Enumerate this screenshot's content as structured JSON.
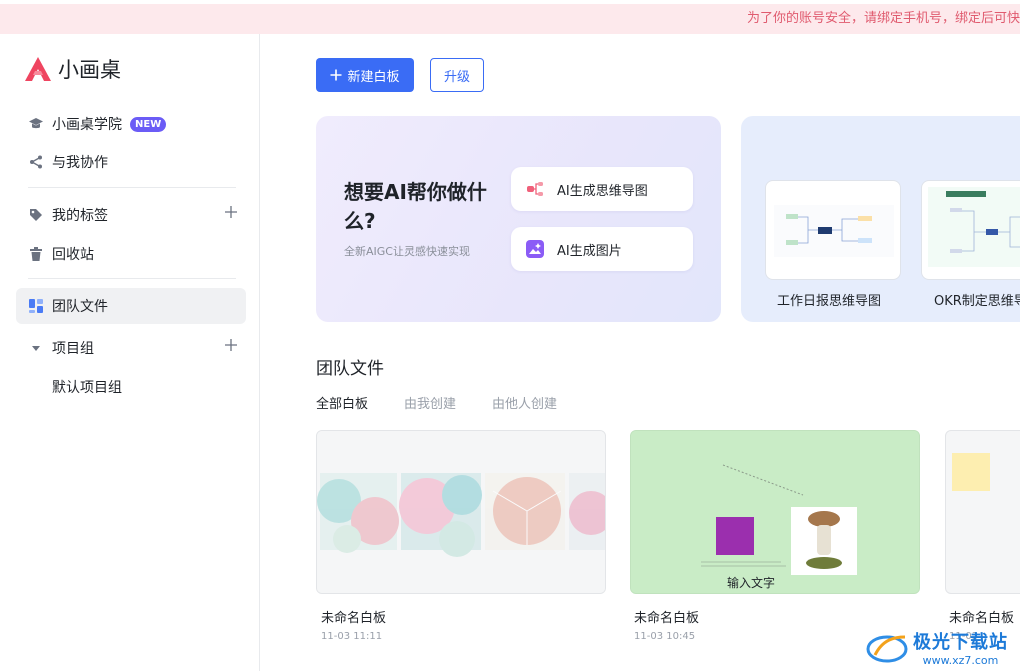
{
  "banner": {
    "text": "为了你的账号安全，请绑定手机号，绑定后可快"
  },
  "app": {
    "name": "小画桌"
  },
  "sidebar": {
    "items": [
      {
        "label": "小画桌学院",
        "badge": "NEW",
        "icon": "graduation-cap-icon"
      },
      {
        "label": "与我协作",
        "icon": "share-icon"
      },
      {
        "label": "我的标签",
        "icon": "tag-icon"
      },
      {
        "label": "回收站",
        "icon": "trash-icon"
      },
      {
        "label": "团队文件",
        "icon": "grid-icon"
      },
      {
        "label": "项目组",
        "icon": "caret-down-icon"
      },
      {
        "label": "默认项目组"
      }
    ]
  },
  "toolbar": {
    "new_label": "新建白板",
    "upgrade_label": "升级"
  },
  "ai_card": {
    "title": "想要AI帮你做什么?",
    "subtitle": "全新AIGC让灵感快速实现",
    "buttons": [
      {
        "label": "AI生成思维导图",
        "icon": "mindmap-icon"
      },
      {
        "label": "AI生成图片",
        "icon": "image-icon"
      }
    ]
  },
  "templates": [
    {
      "label": "工作日报思维导图"
    },
    {
      "label": "OKR制定思维导"
    }
  ],
  "section": {
    "title": "团队文件"
  },
  "tabs": [
    {
      "label": "全部白板",
      "active": true
    },
    {
      "label": "由我创建",
      "active": false
    },
    {
      "label": "由他人创建",
      "active": false
    }
  ],
  "files": [
    {
      "name": "未命名白板",
      "date": "11-03 11:11"
    },
    {
      "name": "未命名白板",
      "date": "11-03 10:45",
      "canvas_text": "输入文字"
    },
    {
      "name": "未命名白板",
      "date": "11-03"
    }
  ],
  "watermark": {
    "text": "极光下载站",
    "url_text": "www.xz7.com"
  },
  "colors": {
    "primary": "#3a6cf5",
    "banner_bg": "#fde9ec",
    "banner_text": "#e05b6f",
    "badge": "#6b5cf6"
  }
}
